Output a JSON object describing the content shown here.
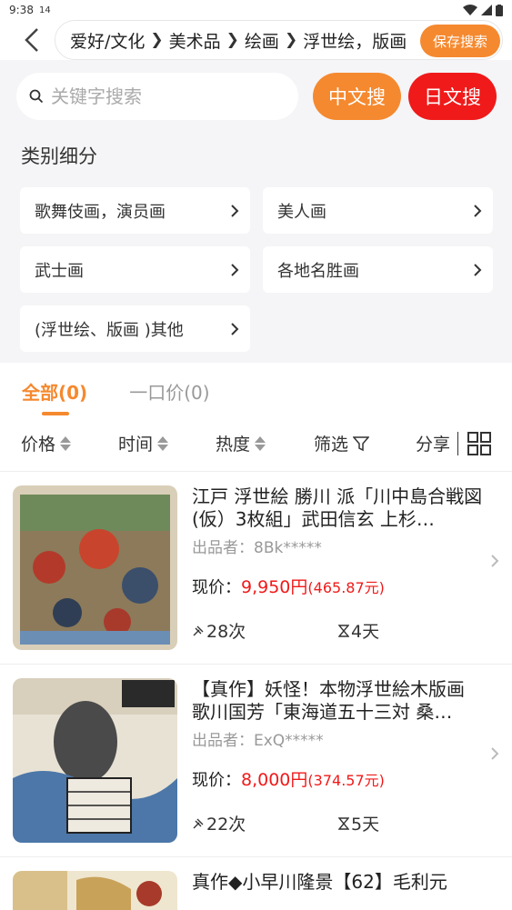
{
  "status": {
    "time": "9:38",
    "extra": "14"
  },
  "breadcrumbs": [
    "爱好/文化",
    "美术品",
    "绘画",
    "浮世绘，版画"
  ],
  "save_search_label": "保存搜索",
  "search": {
    "placeholder": "关键字搜索",
    "cn_button": "中文搜",
    "jp_button": "日文搜"
  },
  "categories": {
    "title": "类别细分",
    "items": [
      {
        "label": "歌舞伎画，演员画"
      },
      {
        "label": "美人画"
      },
      {
        "label": "武士画"
      },
      {
        "label": "各地名胜画"
      },
      {
        "label": "(浮世绘、版画 )其他"
      }
    ]
  },
  "tabs": [
    {
      "label": "全部(0)",
      "active": true
    },
    {
      "label": "一口价(0)",
      "active": false
    }
  ],
  "sort": {
    "price": "价格",
    "time": "时间",
    "popularity": "热度",
    "filter": "筛选",
    "share": "分享"
  },
  "listings": [
    {
      "title": "江戸 浮世絵 勝川 派「川中島合戦図(仮）3枚組」武田信玄 上杉…",
      "seller": "出品者：8Bk*****",
      "price_label": "现价：",
      "price": "9,950円",
      "price_cny": "(465.87元)",
      "bids": "28次",
      "time_left": "4天"
    },
    {
      "title": "【真作】妖怪！本物浮世絵木版画 歌川国芳「東海道五十三対 桑…",
      "seller": "出品者：ExQ*****",
      "price_label": "现价：",
      "price": "8,000円",
      "price_cny": "(374.57元)",
      "bids": "22次",
      "time_left": "5天"
    },
    {
      "title": "真作◆小早川隆景【62】毛利元"
    }
  ],
  "colors": {
    "accent": "#f5892f",
    "red": "#f01a1a"
  }
}
